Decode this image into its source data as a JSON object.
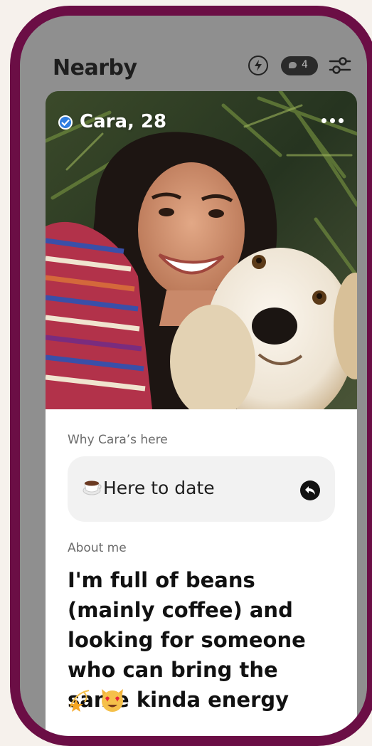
{
  "header": {
    "title": "Nearby",
    "chat_count": "4",
    "icons": [
      "bolt-icon",
      "chat-bubble-icon",
      "filters-icon"
    ]
  },
  "profile": {
    "name_age": "Cara, 28",
    "verified": true,
    "photo_alt": "Woman smiling with a golden retriever"
  },
  "intent": {
    "label": "Why Cara’s here",
    "value": "Here to date",
    "emoji": "coffee-cup"
  },
  "about": {
    "label": "About me",
    "text": "I'm full of beans (mainly coffee) and looking for someone who can bring the same kinda energy",
    "emojis": [
      "dizzy-star",
      "heart-eyes-cat"
    ]
  },
  "colors": {
    "frame": "#6b0e45",
    "background": "#f6f1ec",
    "verified_blue": "#2f7de0"
  }
}
